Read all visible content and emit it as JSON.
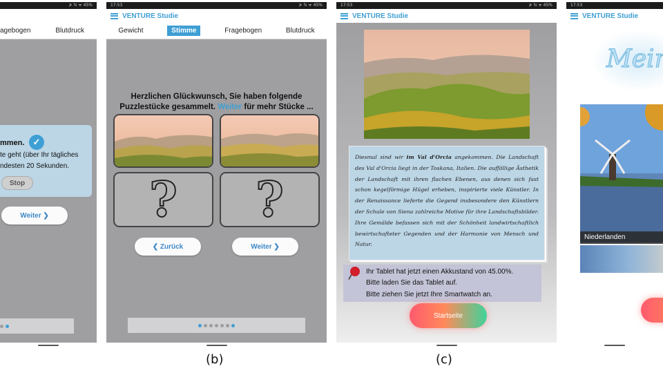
{
  "status": {
    "time": "17:53",
    "icons": "⊁ ℕ ᯤ 45%"
  },
  "app": {
    "title": "VENTURE Studie"
  },
  "panel_a": {
    "tabs": [
      "agebogen",
      "Blutdruck"
    ],
    "text_title": "mmen.",
    "text_line1": "te geht (über Ihr tägliches",
    "text_line2": "ndesten 20 Sekunden.",
    "stop_label": "Stop",
    "next_label": "Weiter ❯"
  },
  "panel_b": {
    "tabs": [
      "Gewicht",
      "Stimme",
      "Fragebogen",
      "Blutdruck"
    ],
    "active_tab": "Stimme",
    "congrats_part1": "Herzlichen Glückwunsch, Sie haben folgende",
    "congrats_part2": "Puzzlestücke gesammelt.",
    "congrats_link": "Weiter",
    "congrats_part3": "für mehr Stücke ...",
    "back_label": "❮ Zurück",
    "next_label": "Weiter ❯",
    "unknown_glyph": "?",
    "dots_total": 7,
    "dots_active": 6
  },
  "panel_c": {
    "story": [
      "Diesmal sind wir ",
      "im Val d'Orcia",
      " angekommen. Die Landschaft des Val d'Orcia liegt in der Toskana, Italien. Die auffällige Ästhetik der Landschaft mit ihren flachen Ebenen, aus denen sich fast schon kegelförmige Hügel erheben, inspirierte viele Künstler. In der Renaissance lieferte die Gegend insbesondere den Künstlern der Schule von Siena zahlreiche Motive für ihre Landschaftsbilder. Ihre Gemälde befassen sich mit der Schönheit landwirtschaftlich bewirtschafteter Gegenden und der Harmonie von Mensch und Natur."
    ],
    "battery_line": "Ihr Tablet hat jetzt einen Akkustand von 45.00%.",
    "charge_line": "Bitte laden Sie das Tablet auf.",
    "watch_line": "Bitte ziehen Sie jetzt Ihre Smartwatch an.",
    "home_label": "Startseite"
  },
  "panel_d": {
    "logo_text": "Mein",
    "photo_label": "Niederlanden"
  },
  "captions": {
    "b": "(b)",
    "c": "(c)"
  },
  "colors": {
    "accent": "#3f9fd4",
    "panel_bg": "#9f9fa1",
    "home_gradient": [
      "#ff5a6e",
      "#3fd39a"
    ]
  }
}
